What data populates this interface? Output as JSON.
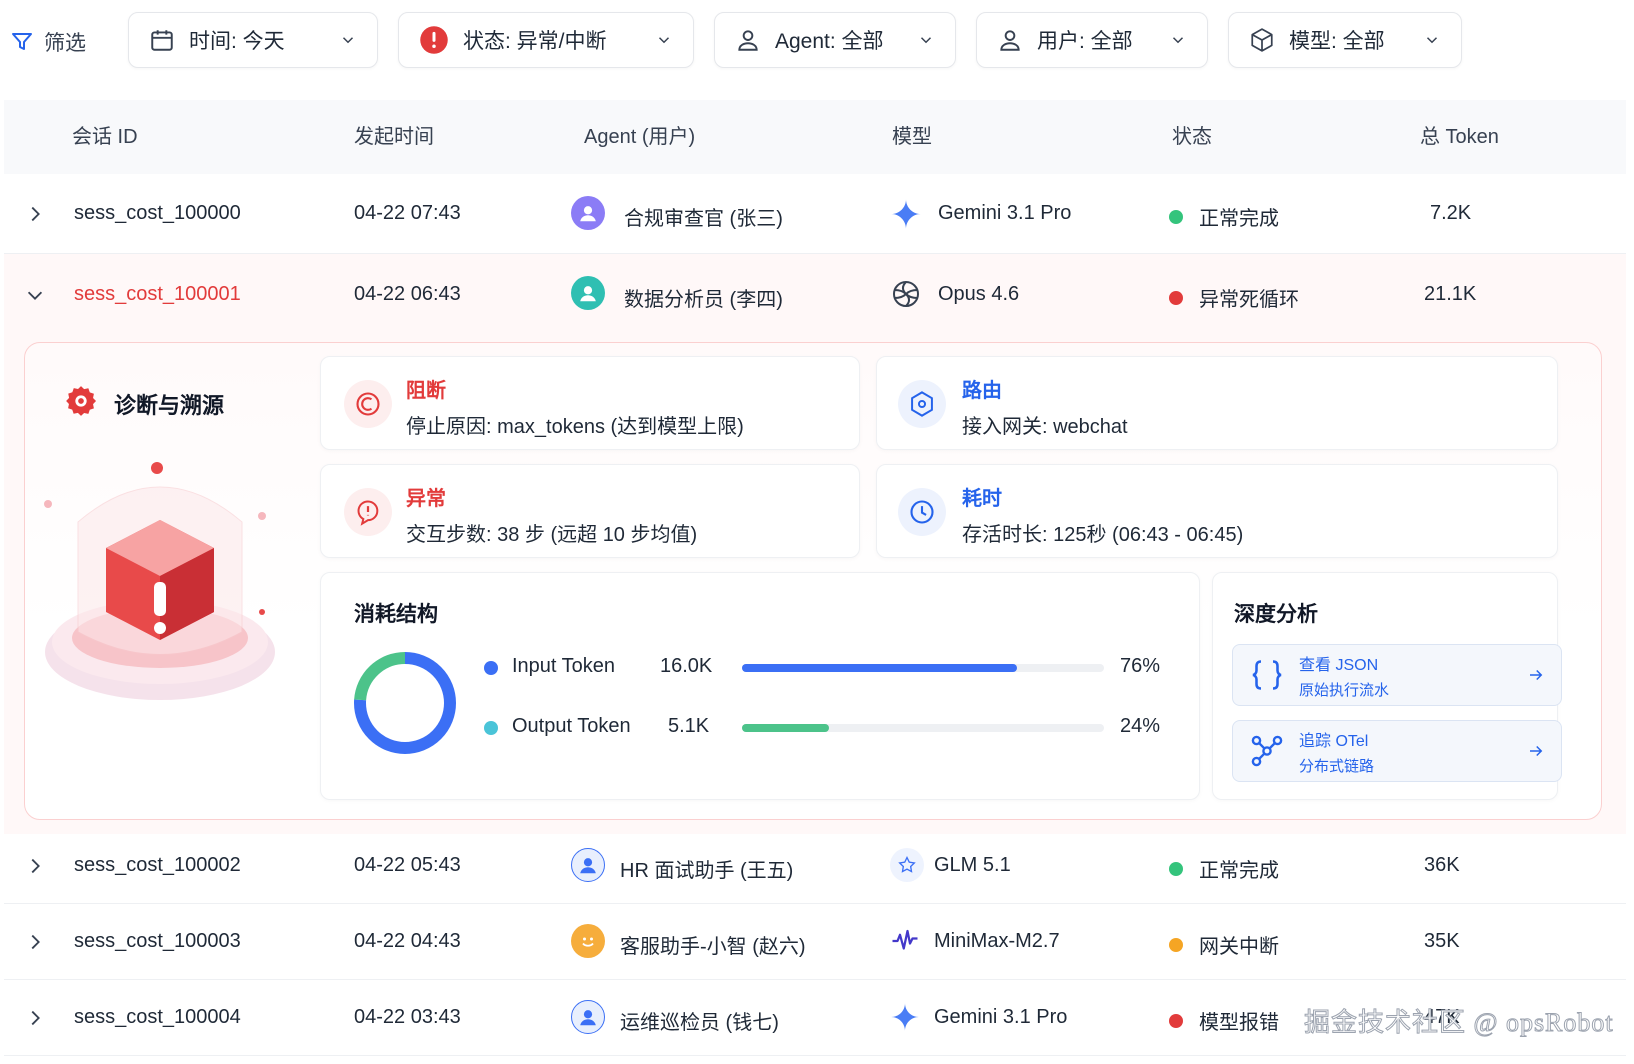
{
  "filters": {
    "label": "筛选",
    "time": "时间: 今天",
    "status": "状态: 异常/中断",
    "agent": "Agent: 全部",
    "user": "用户: 全部",
    "model": "模型: 全部"
  },
  "table": {
    "headers": [
      "会话 ID",
      "发起时间",
      "Agent (用户)",
      "模型",
      "状态",
      "总 Token"
    ],
    "rows": [
      {
        "id": "sess_cost_100000",
        "time": "04-22 07:43",
        "agent": "合规审查官 (张三)",
        "model": "Gemini 3.1 Pro",
        "status": "正常完成",
        "tokens": "7.2K",
        "status_color": "#34c47c"
      },
      {
        "id": "sess_cost_100001",
        "time": "04-22 06:43",
        "agent": "数据分析员 (李四)",
        "model": "Opus 4.6",
        "status": "异常死循环",
        "tokens": "21.1K",
        "status_color": "#e23b3b"
      },
      {
        "id": "sess_cost_100002",
        "time": "04-22 05:43",
        "agent": "HR 面试助手 (王五)",
        "model": "GLM 5.1",
        "status": "正常完成",
        "tokens": "36K",
        "status_color": "#34c47c"
      },
      {
        "id": "sess_cost_100003",
        "time": "04-22 04:43",
        "agent": "客服助手-小智 (赵六)",
        "model": "MiniMax-M2.7",
        "status": "网关中断",
        "tokens": "35K",
        "status_color": "#f5a524"
      },
      {
        "id": "sess_cost_100004",
        "time": "04-22 03:43",
        "agent": "运维巡检员 (钱七)",
        "model": "Gemini 3.1 Pro",
        "status": "模型报错",
        "tokens": "47K",
        "status_color": "#e23b3b"
      }
    ]
  },
  "detail": {
    "title": "诊断与溯源",
    "cards": {
      "block": {
        "title": "阻断",
        "text": "停止原因:  max_tokens (达到模型上限)"
      },
      "route": {
        "title": "路由",
        "text": "接入网关:  webchat"
      },
      "anomaly": {
        "title": "异常",
        "text": "交互步数:  38  步  (远超  10  步均值)"
      },
      "duration": {
        "title": "耗时",
        "text": "存活时长:  125秒  (06:43  -  06:45)"
      }
    },
    "consumption": {
      "title": "消耗结构",
      "items": [
        {
          "label": "Input Token",
          "value": "16.0K",
          "percent": "76%",
          "fraction": 0.76,
          "color": "#3b6ff5"
        },
        {
          "label": "Output Token",
          "value": "5.1K",
          "percent": "24%",
          "fraction": 0.24,
          "color": "#4cc38a"
        }
      ]
    },
    "deep": {
      "title": "深度分析",
      "json_title": "查看 JSON",
      "json_sub": "原始执行流水",
      "otel_title": "追踪 OTel",
      "otel_sub": "分布式链路"
    }
  },
  "watermark": "掘金技术社区 @ opsRobot"
}
